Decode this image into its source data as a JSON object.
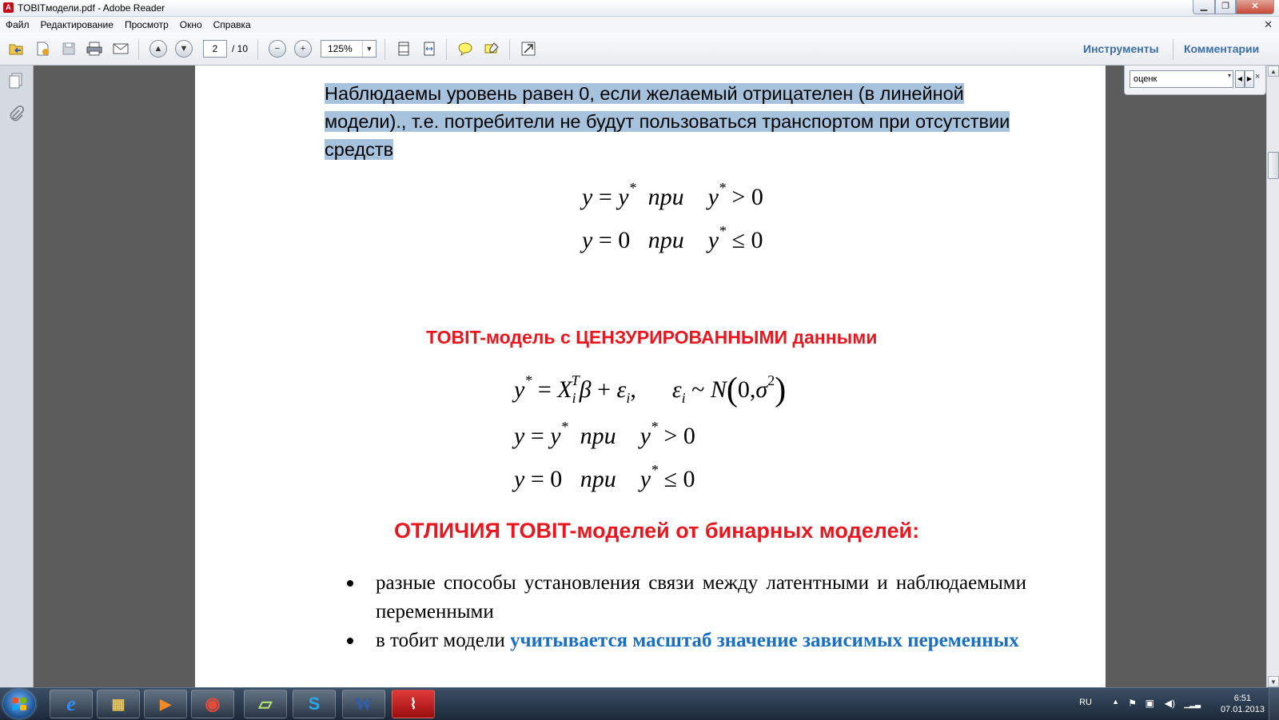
{
  "window": {
    "title": "TOBITмодели.pdf - Adobe Reader",
    "min_glyph": "▁",
    "max_glyph": "❐",
    "close_glyph": "✕",
    "app_icon_glyph": "A"
  },
  "menu": {
    "items": [
      "Файл",
      "Редактирование",
      "Просмотр",
      "Окно",
      "Справка"
    ],
    "close_glyph": "✕"
  },
  "toolbar": {
    "page_current": "2",
    "page_total": "/ 10",
    "zoom": "125%",
    "tools_label": "Инструменты",
    "comments_label": "Комментарии"
  },
  "search": {
    "value": "оценк",
    "prev_glyph": "◀",
    "next_glyph": "▶",
    "dropdown_glyph": "▾",
    "close_glyph": "×"
  },
  "document": {
    "para_highlighted": "Наблюдаемы уровень равен 0, если желаемый отрицателен (в линейной модели)., т.е. потребители не будут пользоваться транспортом при отсутствии средств",
    "heading_tobit": "TOBIT-модель с ЦЕНЗУРИРОВАННЫМИ данными",
    "heading_diff": "ОТЛИЧИЯ TOBIT-моделей от бинарных моделей:",
    "bullet1": "разные способы установления связи между латентными и наблюдаемыми переменными",
    "bullet2_plain": "в тобит модели ",
    "bullet2_blue": "учитывается масштаб значение зависимых переменных",
    "eq": {
      "y": "y",
      "eq_sign": "=",
      "star": "*",
      "zero": "0",
      "pri": "при",
      "gt": "> 0",
      "le": "≤ 0",
      "X": "X",
      "i": "i",
      "T": "T",
      "beta": "β",
      "plus": "+",
      "eps": "ε",
      "comma": ",",
      "tilde": "~",
      "N": "N",
      "lparen": "(",
      "rparen": ")",
      "zero_comma": "0,",
      "sigma": "σ",
      "two": "2"
    }
  },
  "taskbar": {
    "lang": "RU",
    "time": "6:51",
    "date": "07.01.2013",
    "apps": [
      {
        "glyph": "e"
      },
      {
        "glyph": "▦"
      },
      {
        "glyph": "▶"
      },
      {
        "glyph": "◉"
      },
      {
        "glyph": "▱"
      },
      {
        "glyph": "S"
      },
      {
        "glyph": "W"
      },
      {
        "glyph": "⌇"
      }
    ],
    "tray_glyphs": [
      "▲",
      "⚑",
      "▣",
      "◀)",
      "▁▂▃"
    ]
  },
  "colors": {
    "accent_red": "#e8171f",
    "accent_blue": "#1b6fc2",
    "highlight": "#a7c2dd"
  }
}
